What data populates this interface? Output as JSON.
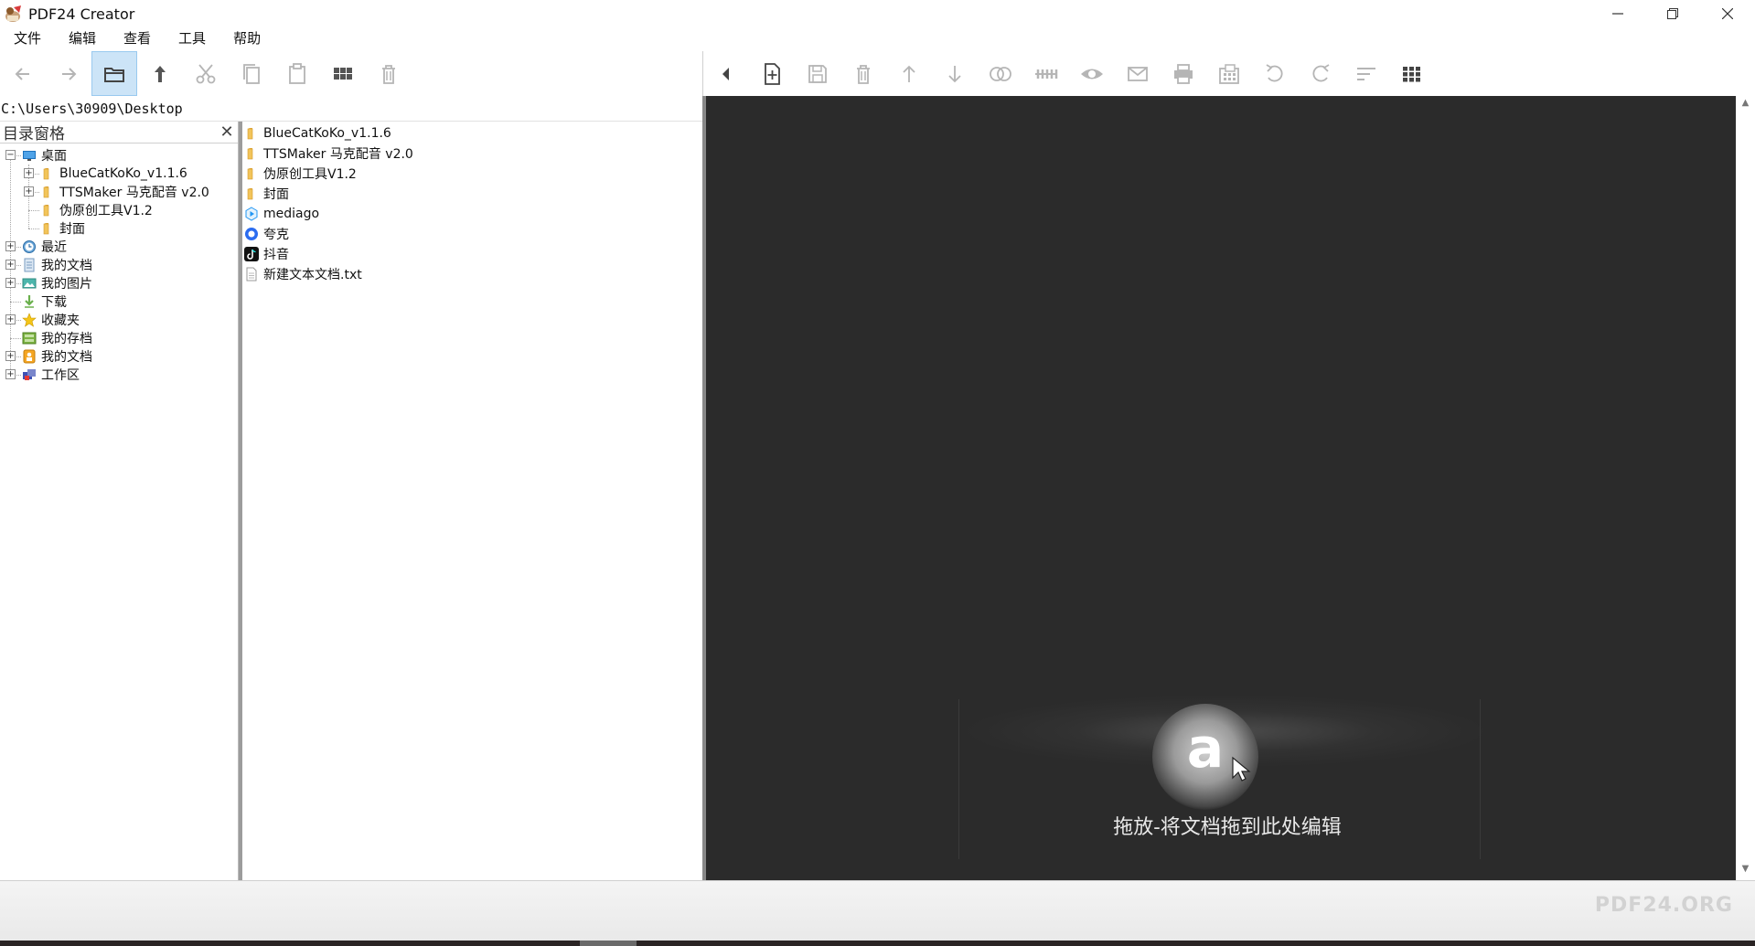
{
  "window": {
    "title": "PDF24 Creator",
    "controls": [
      "minimize",
      "restore",
      "close"
    ]
  },
  "menu": {
    "items": [
      "文件",
      "编辑",
      "查看",
      "工具",
      "帮助"
    ]
  },
  "toolbar_left": {
    "buttons": [
      "back-arrow-icon",
      "forward-arrow-icon",
      "folder-icon",
      "up-arrow-icon",
      "cut-icon",
      "copy-icon",
      "paste-icon",
      "grid-view-icon",
      "trash-icon"
    ],
    "active": "folder-icon"
  },
  "toolbar_right": {
    "buttons": [
      "collapse-left-icon",
      "new-file-icon",
      "save-icon",
      "trash-icon",
      "move-up-icon",
      "move-down-icon",
      "merge-icon",
      "split-icon",
      "preview-eye-icon",
      "email-icon",
      "print-icon",
      "fax-icon",
      "rotate-left-icon",
      "rotate-right-icon",
      "sort-icon",
      "thumbnail-grid-icon"
    ]
  },
  "path": "C:\\Users\\30909\\Desktop",
  "directory_pane": {
    "title": "目录窗格",
    "tree": [
      {
        "label": "桌面",
        "level": 0,
        "expander": "minus",
        "icon": "desktop"
      },
      {
        "label": "BlueCatKoKo_v1.1.6",
        "level": 1,
        "expander": "plus",
        "icon": "folder"
      },
      {
        "label": "TTSMaker 马克配音 v2.0",
        "level": 1,
        "expander": "plus",
        "icon": "folder"
      },
      {
        "label": "伪原创工具V1.2",
        "level": 1,
        "expander": "",
        "icon": "folder"
      },
      {
        "label": "封面",
        "level": 1,
        "expander": "",
        "icon": "folder"
      },
      {
        "label": "最近",
        "level": 0,
        "expander": "plus",
        "icon": "recent"
      },
      {
        "label": "我的文档",
        "level": 0,
        "expander": "plus",
        "icon": "documents"
      },
      {
        "label": "我的图片",
        "level": 0,
        "expander": "plus",
        "icon": "pictures"
      },
      {
        "label": "下载",
        "level": 0,
        "expander": "",
        "icon": "download"
      },
      {
        "label": "收藏夹",
        "level": 0,
        "expander": "plus",
        "icon": "star"
      },
      {
        "label": "我的存档",
        "level": 0,
        "expander": "",
        "icon": "archive"
      },
      {
        "label": "我的文档",
        "level": 0,
        "expander": "plus",
        "icon": "mydocs"
      },
      {
        "label": "工作区",
        "level": 0,
        "expander": "plus",
        "icon": "workspace"
      }
    ]
  },
  "file_list": [
    {
      "name": "BlueCatKoKo_v1.1.6",
      "icon": "folder"
    },
    {
      "name": "TTSMaker 马克配音 v2.0",
      "icon": "folder"
    },
    {
      "name": "伪原创工具V1.2",
      "icon": "folder"
    },
    {
      "name": "封面",
      "icon": "folder"
    },
    {
      "name": "mediago",
      "icon": "mediago"
    },
    {
      "name": "夸克",
      "icon": "quark"
    },
    {
      "name": "抖音",
      "icon": "douyin"
    },
    {
      "name": "新建文本文档.txt",
      "icon": "text-file"
    }
  ],
  "preview": {
    "drop_text": "拖放-将文档拖到此处编辑",
    "logo_letter": "a"
  },
  "status": {
    "brand": "PDF24.ORG"
  },
  "colors": {
    "preview_bg": "#2b2b2b",
    "active_button": "#cce4f7",
    "folder": "#f2c45a",
    "icon_dark": "#555555",
    "icon_light": "#b5b5b5"
  }
}
